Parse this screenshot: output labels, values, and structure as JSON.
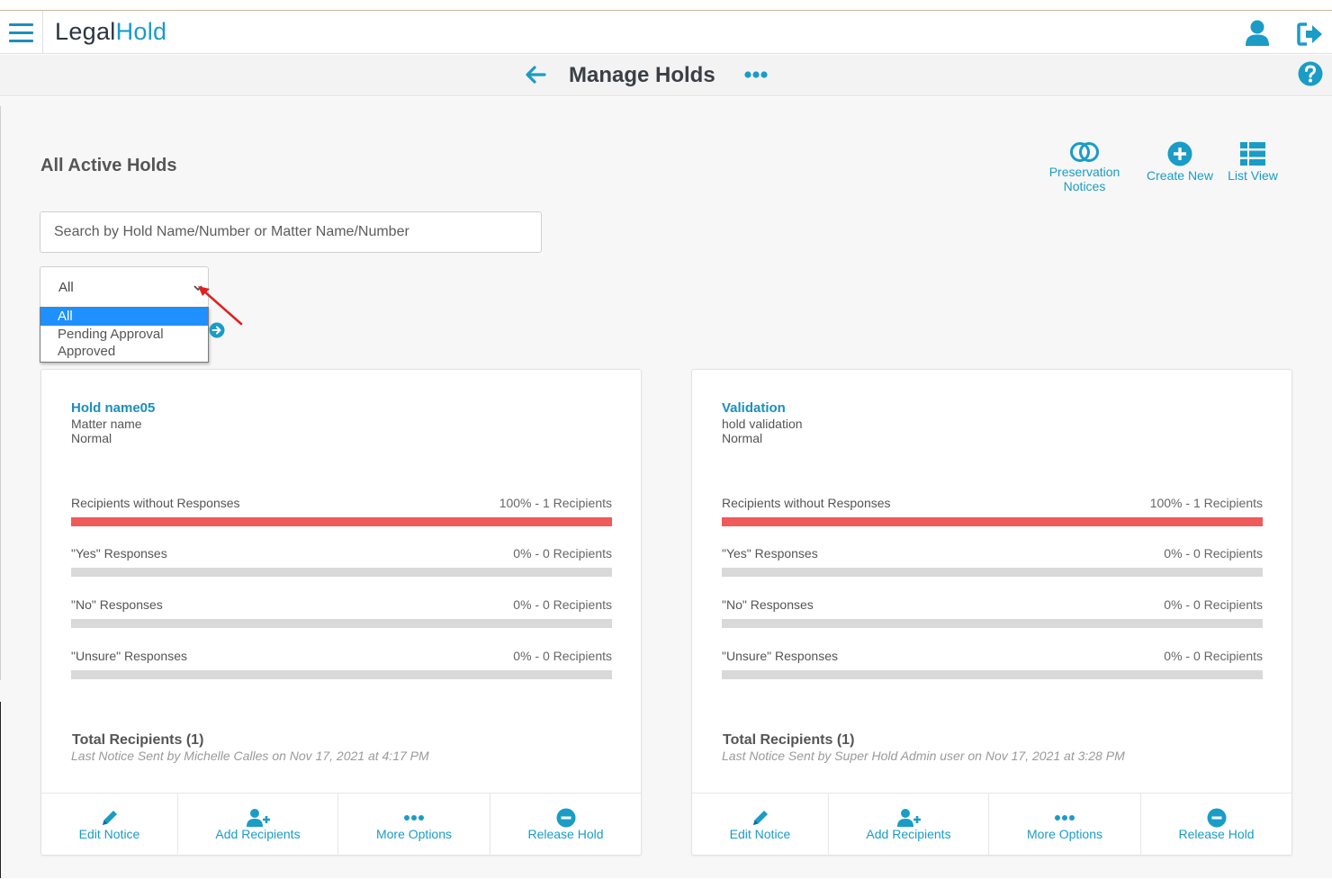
{
  "app": {
    "logo_part1": "Legal",
    "logo_part2": "Hold"
  },
  "header": {
    "title": "Manage Holds"
  },
  "section": {
    "title": "All Active Holds"
  },
  "actions": {
    "preservation_line1": "Preservation",
    "preservation_line2": "Notices",
    "create_new": "Create New",
    "list_view": "List View"
  },
  "search": {
    "placeholder": "Search by Hold Name/Number or Matter Name/Number",
    "value": ""
  },
  "filter": {
    "selected": "All",
    "options": [
      "All",
      "Pending Approval",
      "Approved"
    ],
    "highlighted_index": 0
  },
  "colors": {
    "accent": "#1a9cc7",
    "bar_red": "#f05a5a",
    "bar_grey": "#d9d9d9",
    "option_highlight": "#1e90ff",
    "annotation_arrow": "#e02020"
  },
  "icons": {
    "menu": "hamburger-icon",
    "user": "user-icon",
    "logout": "logout-icon",
    "back": "arrow-left-icon",
    "more": "ellipsis-icon",
    "help": "question-circle-icon",
    "preservation": "toggle-circles-icon",
    "create": "plus-circle-icon",
    "list": "list-view-icon",
    "go": "arrow-right-circle-icon",
    "edit": "pencil-icon",
    "add_recipients": "user-plus-icon",
    "more_options": "ellipsis-icon",
    "release": "minus-circle-icon"
  },
  "holds": [
    {
      "name": "Hold name05",
      "matter": "Matter name",
      "level": "Normal",
      "metrics": [
        {
          "label": "Recipients without Responses",
          "value": "100% - 1 Recipients",
          "percent": 100
        },
        {
          "label": "\"Yes\" Responses",
          "value": "0% - 0 Recipients",
          "percent": 0
        },
        {
          "label": "\"No\" Responses",
          "value": "0% - 0 Recipients",
          "percent": 0
        },
        {
          "label": "\"Unsure\" Responses",
          "value": "0% - 0 Recipients",
          "percent": 0
        }
      ],
      "total": "Total Recipients (1)",
      "last_notice": "Last Notice Sent by Michelle Calles on Nov 17, 2021 at 4:17 PM",
      "buttons": {
        "edit": "Edit Notice",
        "add": "Add Recipients",
        "more": "More Options",
        "release": "Release Hold"
      }
    },
    {
      "name": "Validation",
      "matter": "hold validation",
      "level": "Normal",
      "metrics": [
        {
          "label": "Recipients without Responses",
          "value": "100% - 1 Recipients",
          "percent": 100
        },
        {
          "label": "\"Yes\" Responses",
          "value": "0% - 0 Recipients",
          "percent": 0
        },
        {
          "label": "\"No\" Responses",
          "value": "0% - 0 Recipients",
          "percent": 0
        },
        {
          "label": "\"Unsure\" Responses",
          "value": "0% - 0 Recipients",
          "percent": 0
        }
      ],
      "total": "Total Recipients (1)",
      "last_notice": "Last Notice Sent by Super Hold Admin user on Nov 17, 2021 at 3:28 PM",
      "buttons": {
        "edit": "Edit Notice",
        "add": "Add Recipients",
        "more": "More Options",
        "release": "Release Hold"
      }
    }
  ]
}
